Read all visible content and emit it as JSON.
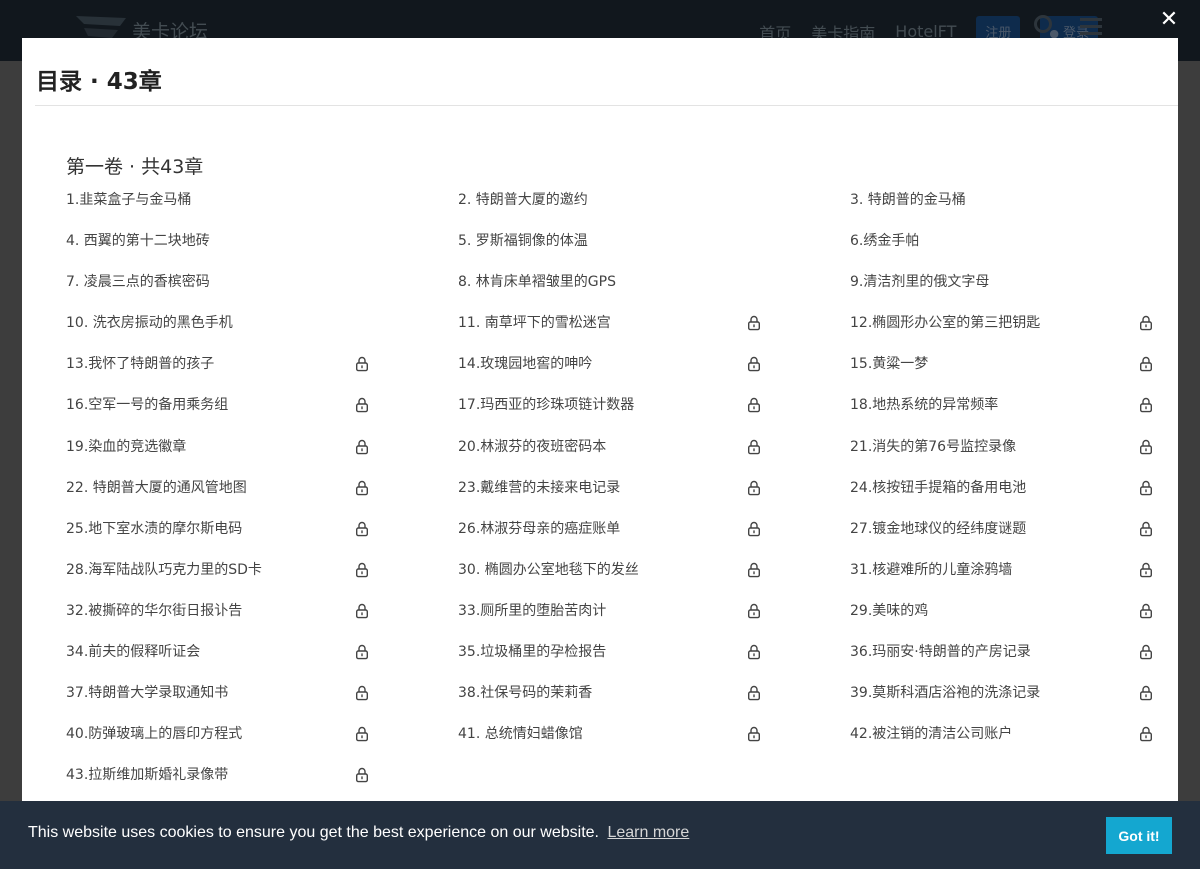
{
  "site": {
    "name": "美卡论坛",
    "nav": [
      "首页",
      "美卡指南",
      "HotelFT"
    ],
    "register_label": "注册",
    "login_label": "登录"
  },
  "modal": {
    "title": "目录 · 43章",
    "close_glyph": "✕",
    "volume_title": "第一卷 · 共43章"
  },
  "chapters": [
    {
      "title": "1.韭菜盒子与金马桶",
      "locked": false
    },
    {
      "title": "2. 特朗普大厦的邀约",
      "locked": false
    },
    {
      "title": "3. 特朗普的金马桶",
      "locked": false
    },
    {
      "title": "4. 西翼的第十二块地砖",
      "locked": false
    },
    {
      "title": "5. 罗斯福铜像的体温",
      "locked": false
    },
    {
      "title": "6.绣金手帕",
      "locked": false
    },
    {
      "title": "7. 凌晨三点的香槟密码",
      "locked": false
    },
    {
      "title": "8. 林肯床单褶皱里的GPS",
      "locked": false
    },
    {
      "title": "9.清洁剂里的俄文字母",
      "locked": false
    },
    {
      "title": "10. 洗衣房振动的黑色手机",
      "locked": false
    },
    {
      "title": "11. 南草坪下的雪松迷宫",
      "locked": true
    },
    {
      "title": "12.椭圆形办公室的第三把钥匙",
      "locked": true
    },
    {
      "title": "13.我怀了特朗普的孩子",
      "locked": true
    },
    {
      "title": "14.玫瑰园地窖的呻吟",
      "locked": true
    },
    {
      "title": "15.黄粱一梦",
      "locked": true
    },
    {
      "title": "16.空军一号的备用乘务组",
      "locked": true
    },
    {
      "title": "17.玛西亚的珍珠项链计数器",
      "locked": true
    },
    {
      "title": "18.地热系统的异常频率",
      "locked": true
    },
    {
      "title": "19.染血的竞选徽章",
      "locked": true
    },
    {
      "title": "20.林淑芬的夜班密码本",
      "locked": true
    },
    {
      "title": "21.消失的第76号监控录像",
      "locked": true
    },
    {
      "title": "22. 特朗普大厦的通风管地图",
      "locked": true
    },
    {
      "title": "23.戴维营的未接来电记录",
      "locked": true
    },
    {
      "title": "24.核按钮手提箱的备用电池",
      "locked": true
    },
    {
      "title": "25.地下室水渍的摩尔斯电码",
      "locked": true
    },
    {
      "title": "26.林淑芬母亲的癌症账单",
      "locked": true
    },
    {
      "title": "27.镀金地球仪的经纬度谜题",
      "locked": true
    },
    {
      "title": "28.海军陆战队巧克力里的SD卡",
      "locked": true
    },
    {
      "title": "30. 椭圆办公室地毯下的发丝",
      "locked": true
    },
    {
      "title": "31.核避难所的儿童涂鸦墙",
      "locked": true
    },
    {
      "title": "32.被撕碎的华尔街日报讣告",
      "locked": true
    },
    {
      "title": "33.厕所里的堕胎苦肉计",
      "locked": true
    },
    {
      "title": "29.美味的鸡",
      "locked": true
    },
    {
      "title": "34.前夫的假释听证会",
      "locked": true
    },
    {
      "title": "35.垃圾桶里的孕检报告",
      "locked": true
    },
    {
      "title": "36.玛丽安·特朗普的产房记录",
      "locked": true
    },
    {
      "title": "37.特朗普大学录取通知书",
      "locked": true
    },
    {
      "title": "38.社保号码的茉莉香",
      "locked": true
    },
    {
      "title": "39.莫斯科酒店浴袍的洗涤记录",
      "locked": true
    },
    {
      "title": "40.防弹玻璃上的唇印方程式",
      "locked": true
    },
    {
      "title": "41. 总统情妇蜡像馆",
      "locked": true
    },
    {
      "title": "42.被注销的清洁公司账户",
      "locked": true
    },
    {
      "title": "43.拉斯维加斯婚礼录像带",
      "locked": true
    }
  ],
  "cookie": {
    "message": "This website uses cookies to ensure you get the best experience on our website.",
    "learn_more": "Learn more",
    "accept": "Got it!"
  },
  "colors": {
    "accent": "#14a7d0",
    "cookie_bg": "#232f3e",
    "header_bg": "#1f2b35"
  }
}
